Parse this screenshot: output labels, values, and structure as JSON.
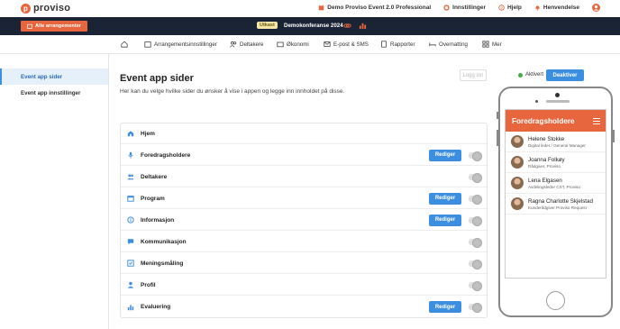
{
  "brand": {
    "name": "proviso",
    "mark": "p"
  },
  "topbar": {
    "event_title": "Demo Proviso Event 2.0 Professional",
    "settings": "Innstillinger",
    "help": "Hjelp",
    "notices": "Henvendelse"
  },
  "darkbar": {
    "all_events": "Alle arrangementer",
    "badge": "Utkast",
    "conference": "Demokonferanse 2024"
  },
  "nav": {
    "items": [
      {
        "label": "Arrangementsinnstillinger",
        "icon": "calendar-settings-icon"
      },
      {
        "label": "Deltakere",
        "icon": "people-icon"
      },
      {
        "label": "Økonomi",
        "icon": "wallet-icon"
      },
      {
        "label": "E-post & SMS",
        "icon": "mail-icon"
      },
      {
        "label": "Rapporter",
        "icon": "report-icon"
      },
      {
        "label": "Overnatting",
        "icon": "bed-icon"
      },
      {
        "label": "Mer",
        "icon": "grid-icon"
      }
    ]
  },
  "sidebar": {
    "items": [
      {
        "label": "Event app sider",
        "active": true
      },
      {
        "label": "Event app innstillinger",
        "active": false
      }
    ]
  },
  "main": {
    "title": "Event app sider",
    "description": "Her kan du velge hvilke sider du ønsker å vise i appen og legge inn innholdet på disse.",
    "login_label": "Logg inn",
    "status_label": "Aktivert",
    "deactivate_label": "Deaktiver",
    "edit_label": "Rediger",
    "rows": [
      {
        "label": "Hjem",
        "icon": "home-icon",
        "editable": false,
        "toggle": false
      },
      {
        "label": "Foredragsholdere",
        "icon": "microphone-icon",
        "editable": true,
        "toggle": true
      },
      {
        "label": "Deltakere",
        "icon": "people-icon",
        "editable": false,
        "toggle": true
      },
      {
        "label": "Program",
        "icon": "calendar-icon",
        "editable": true,
        "toggle": true
      },
      {
        "label": "Informasjon",
        "icon": "info-icon",
        "editable": true,
        "toggle": true
      },
      {
        "label": "Kommunikasjon",
        "icon": "chat-icon",
        "editable": false,
        "toggle": true
      },
      {
        "label": "Meningsmåling",
        "icon": "poll-icon",
        "editable": false,
        "toggle": true
      },
      {
        "label": "Profil",
        "icon": "person-icon",
        "editable": false,
        "toggle": true
      },
      {
        "label": "Evaluering",
        "icon": "bar-chart-icon",
        "editable": true,
        "toggle": true
      }
    ]
  },
  "phone": {
    "header": "Foredragsholdere",
    "speakers": [
      {
        "name": "Helene Stokke",
        "role": "Digital leder / General Manager"
      },
      {
        "name": "Joanna Folkøy",
        "role": "Rådgiver, Proviso"
      },
      {
        "name": "Lena Elgasen",
        "role": "Avdelingsleder CST, Proviso"
      },
      {
        "name": "Ragna Charlotte Skjelstad",
        "role": "Kunderådgiver Proviso Request"
      }
    ]
  },
  "colors": {
    "accent": "#e8663d",
    "primary": "#3b8ee0",
    "dark": "#1b2435",
    "active": "#3cb043"
  }
}
